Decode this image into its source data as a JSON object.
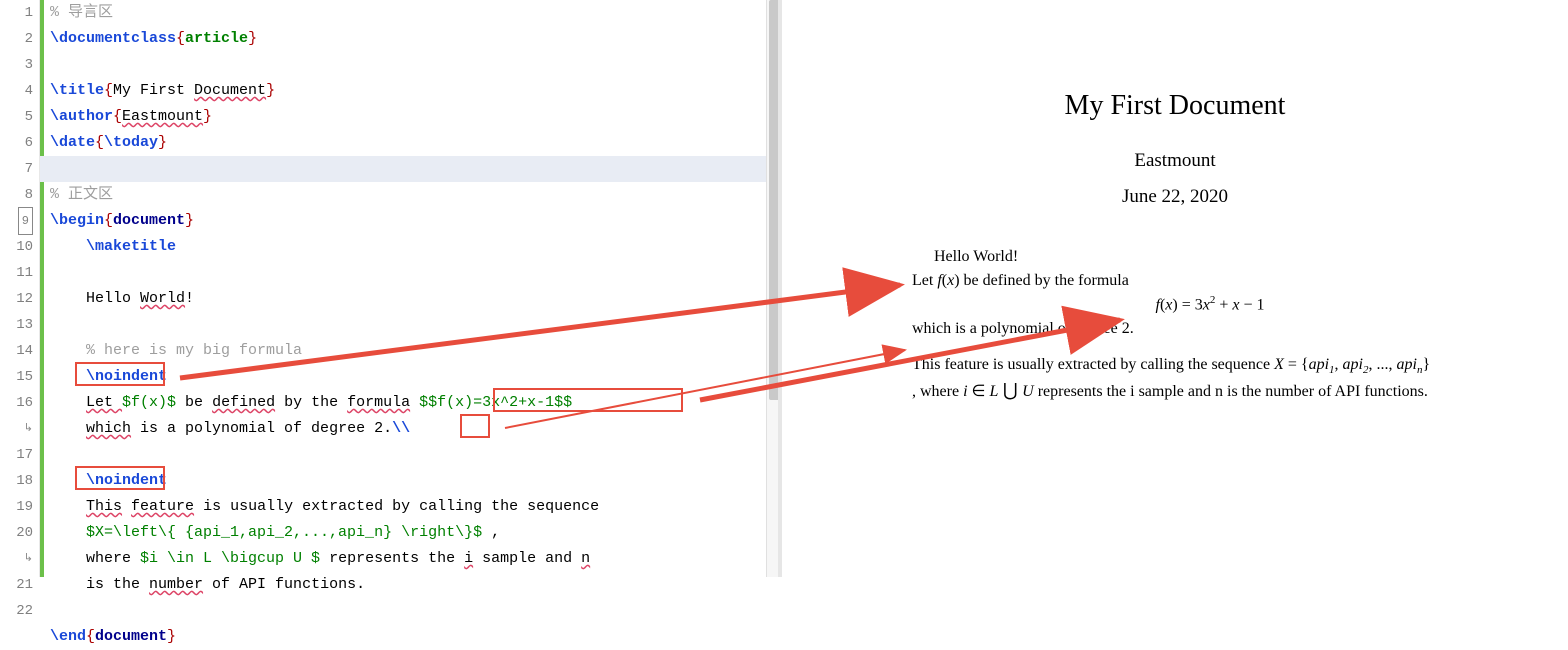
{
  "editor": {
    "gutter": [
      "1",
      "2",
      "3",
      "4",
      "5",
      "6",
      "7",
      "8",
      "9",
      "10",
      "11",
      "12",
      "13",
      "14",
      "15",
      "16",
      "↳",
      "17",
      "18",
      "19",
      "20",
      "↳",
      "21",
      "22"
    ],
    "comment_preamble": "% 导言区",
    "documentclass_cmd": "\\documentclass",
    "brace_open": "{",
    "brace_close": "}",
    "article": "article",
    "title_cmd": "\\title",
    "title_text": "My First ",
    "title_text2": "Document",
    "author_cmd": "\\author",
    "author_text": "Eastmount",
    "date_cmd": "\\date",
    "today_cmd": "\\today",
    "comment_body": "% 正文区",
    "begin_cmd": "\\begin",
    "end_cmd": "\\end",
    "document_kw": "document",
    "maketitle": "\\maketitle",
    "hello1": "Hello ",
    "hello2": "World",
    "hello3": "!",
    "comment_formula": "% here is my big formula",
    "noindent": "\\noindent",
    "let_pre": "Let ",
    "fx_math": "$f(x)$",
    "be_defined": " be ",
    "defined_ul": "defined",
    "by_the": " by the ",
    "formula_ul": "formula",
    "space2": " ",
    "display_math": "$$f(x)=3x^2+x-1$$",
    "which1": "which",
    "which2": " is a polynomial of degree 2.",
    "linebreak": "\\\\",
    "this_feature1": "This",
    "this_feature2": " ",
    "this_feature3": "feature",
    "this_feature4": " is usually extracted by calling the sequence",
    "seq_math": "$X=\\left\\{ {api_1,api_2,...,api_n} \\right\\}$",
    "seq_tail": " ,",
    "where_pre": "where ",
    "where_math": "$i \\in L \\bigcup U $",
    "where_mid": " represents the ",
    "where_i": "i",
    "where_mid2": " sample and ",
    "where_n": "n",
    "is_the": "is the ",
    "number_ul": "number",
    "of_api": " of API functions."
  },
  "render": {
    "title": "My First Document",
    "author": "Eastmount",
    "date": "June 22, 2020",
    "hello": "Hello World!",
    "let_line_pre": "Let ",
    "let_line_f": "f",
    "let_line_x": "x",
    "let_line_post": " be defined by the formula",
    "formula_f": "f",
    "formula_x": "x",
    "formula_eq": " = 3",
    "formula_x2": "x",
    "formula_sup": "2",
    "formula_plus": " + ",
    "formula_xm": "x",
    "formula_minus": " − 1",
    "poly": "which is a polynomial of degree 2.",
    "para2_pre": "This feature is usually extracted by calling the sequence ",
    "para2_X": "X",
    "para2_eq": " = {",
    "para2_api": "api",
    "para2_s1": "1",
    "para2_c1": ", ",
    "para2_s2": "2",
    "para2_c2": ", ..., ",
    "para2_sn": "n",
    "para2_close": "}",
    "para2_line2_pre": ", where ",
    "para2_i": "i",
    "para2_in": " ∈ ",
    "para2_L": "L",
    "para2_union": " ⋃ ",
    "para2_U": "U",
    "para2_rest": " represents the i sample and n is the number of API functions."
  }
}
